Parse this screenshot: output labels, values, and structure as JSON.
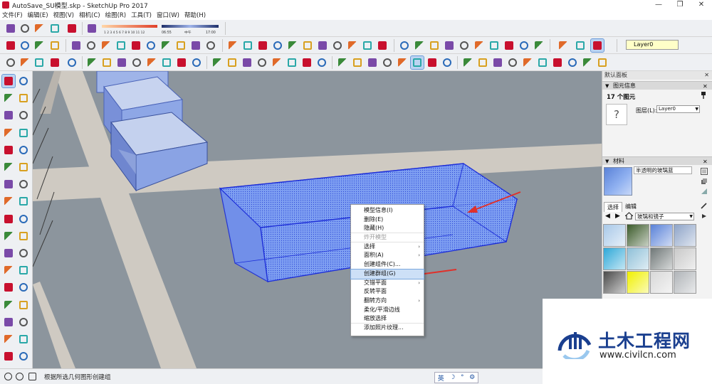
{
  "window": {
    "title": "AutoSave_SU模型.skp - SketchUp Pro 2017",
    "controls": [
      "—",
      "❐",
      "✕"
    ]
  },
  "menus": [
    "文件(F)",
    "编辑(E)",
    "视图(V)",
    "相机(C)",
    "绘图(R)",
    "工具(T)",
    "窗口(W)",
    "帮助(H)"
  ],
  "toolbar": {
    "layer_value": "Layer0",
    "shadow_time_start": "06:55",
    "shadow_time_mid": "中午",
    "shadow_time_end": "17:00",
    "shadow_months": "1 2 3 4 5 6 7 8 9 10 11 12"
  },
  "context_menu": {
    "items": [
      {
        "label": "模型信息(I)",
        "enabled": true,
        "submenu": false,
        "highlighted": false
      },
      {
        "label": "删除(E)",
        "enabled": true,
        "submenu": false,
        "highlighted": false
      },
      {
        "label": "隐藏(H)",
        "enabled": true,
        "submenu": false,
        "highlighted": false
      },
      {
        "label": "炸开模型",
        "enabled": false,
        "submenu": false,
        "highlighted": false
      },
      {
        "label": "选择",
        "enabled": true,
        "submenu": true,
        "highlighted": false
      },
      {
        "label": "面积(A)",
        "enabled": true,
        "submenu": true,
        "highlighted": false
      },
      {
        "label": "创建组件(C)...",
        "enabled": true,
        "submenu": false,
        "highlighted": false
      },
      {
        "label": "创建群组(G)",
        "enabled": true,
        "submenu": false,
        "highlighted": true
      },
      {
        "label": "交错平面",
        "enabled": true,
        "submenu": true,
        "highlighted": false
      },
      {
        "label": "反转平面",
        "enabled": true,
        "submenu": false,
        "highlighted": false
      },
      {
        "label": "翻转方向",
        "enabled": true,
        "submenu": true,
        "highlighted": false
      },
      {
        "label": "柔化/平滑边线",
        "enabled": true,
        "submenu": false,
        "highlighted": false
      },
      {
        "label": "缩放选择",
        "enabled": true,
        "submenu": false,
        "highlighted": false
      },
      {
        "label": "添加照片纹理...",
        "enabled": true,
        "submenu": false,
        "highlighted": false
      }
    ]
  },
  "panel": {
    "tray_title": "默认面板",
    "entity_info": {
      "section_title": "图元信息",
      "count_label": "17 个图元",
      "layer_label": "图层(L):",
      "layer_value": "Layer0",
      "unknown_glyph": "?"
    },
    "materials": {
      "section_title": "材料",
      "material_name": "半透明的玻璃蓝",
      "tabs": [
        "选择",
        "编辑"
      ],
      "library": "玻璃和镜子",
      "swatch_colors": [
        "#a8c8e8",
        "#3b5a2a",
        "#5a82d8",
        "#8ea4c8",
        "#2ea8d8",
        "#8fc0d8",
        "#707878",
        "#c8c8c8",
        "#4a4a4a",
        "#f0f000",
        "#d8d8d8",
        "#b0b4b8"
      ]
    }
  },
  "status": {
    "hint": "根据所选几何图形创建组",
    "ime": [
      "英",
      "☽",
      "°",
      "⚙"
    ]
  },
  "watermark": {
    "name": "土木工程网",
    "url": "www.civilcn.com"
  },
  "colors": {
    "glass_fill": "#7d9ff0",
    "selection_edge": "#1e2fd8",
    "ground": "#8c959d",
    "road": "#cfcac2",
    "arrow": "#e0302a"
  }
}
